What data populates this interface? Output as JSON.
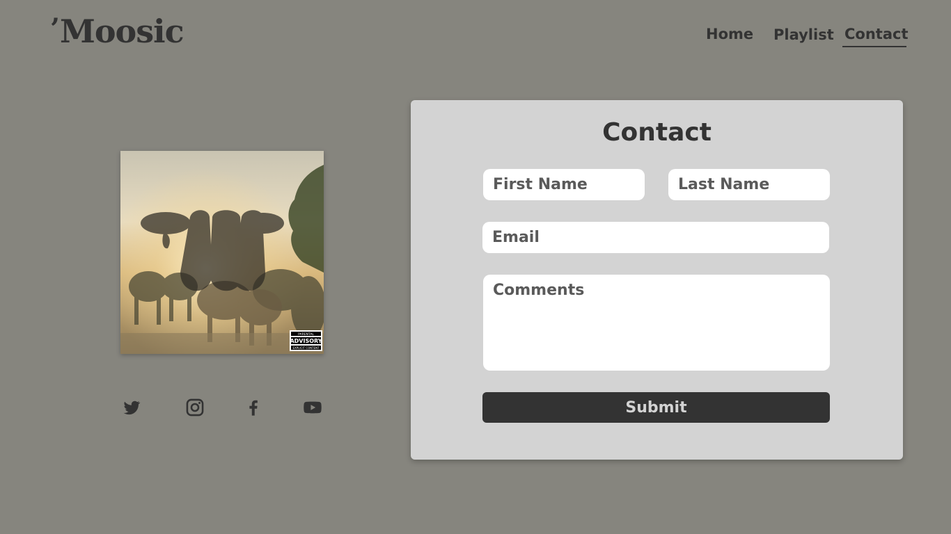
{
  "brand": {
    "name": "Moosic",
    "tick": "’"
  },
  "nav": {
    "items": [
      {
        "label": "Home"
      },
      {
        "label": "Playlist"
      },
      {
        "label": "Contact",
        "active": true
      }
    ]
  },
  "album": {
    "icon": "album-cover-image",
    "badge": {
      "line1": "PARENTAL",
      "line2": "ADVISORY",
      "line3": "EXPLICIT CONTENT"
    }
  },
  "social": [
    {
      "icon": "twitter-icon"
    },
    {
      "icon": "instagram-icon"
    },
    {
      "icon": "facebook-icon"
    },
    {
      "icon": "youtube-icon"
    }
  ],
  "contact": {
    "title": "Contact",
    "first_name_placeholder": "First Name",
    "last_name_placeholder": "Last Name",
    "email_placeholder": "Email",
    "comments_placeholder": "Comments",
    "submit_label": "Submit"
  },
  "colors": {
    "background": "#86857e",
    "card": "#d3d3d3",
    "text": "#333333",
    "button": "#333333"
  }
}
